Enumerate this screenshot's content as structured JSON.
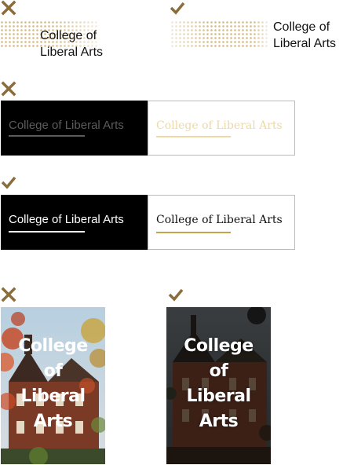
{
  "marks": {
    "wrong_icon": "x-icon",
    "right_icon": "check-icon",
    "color": "#8a6d3b"
  },
  "row1": {
    "wrong_logo": {
      "line1": "College of",
      "line2": "Liberal Arts"
    },
    "right_logo": {
      "line1": "College of",
      "line2": "Liberal Arts"
    }
  },
  "row2": {
    "black_panel_text": "College of Liberal Arts",
    "white_panel_text": "College of Liberal Arts",
    "text_color_dark": "#5c5c5c",
    "text_color_gold": "#ecd9a6"
  },
  "row3": {
    "black_panel_text": "College of Liberal Arts",
    "white_panel_text": "College of Liberal Arts",
    "underline_gold": "#c8a24a"
  },
  "row4": {
    "wrong_photo_title": {
      "w1": "College",
      "w2": "of",
      "w3": "Liberal",
      "w4": "Arts"
    },
    "right_photo_title": {
      "w1": "College",
      "w2": "of",
      "w3": "Liberal",
      "w4": "Arts"
    }
  }
}
